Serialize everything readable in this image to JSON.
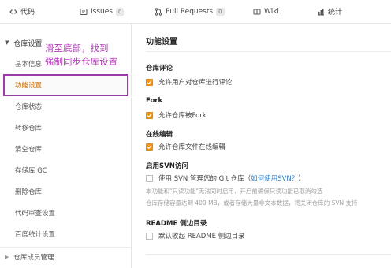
{
  "tabs": [
    {
      "label": "代码",
      "icon": "code-icon"
    },
    {
      "label": "Issues",
      "icon": "issues-icon",
      "count": "0"
    },
    {
      "label": "Pull Requests",
      "icon": "pull-request-icon",
      "count": "0"
    },
    {
      "label": "Wiki",
      "icon": "wiki-icon"
    },
    {
      "label": "统计",
      "icon": "stats-icon"
    }
  ],
  "sidebar": {
    "section": "仓库设置",
    "items": [
      {
        "label": "基本信息"
      },
      {
        "label": "功能设置",
        "active": true
      },
      {
        "label": "仓库状态"
      },
      {
        "label": "转移仓库"
      },
      {
        "label": "清空仓库"
      },
      {
        "label": "存储库 GC"
      },
      {
        "label": "删除仓库"
      },
      {
        "label": "代码审查设置"
      },
      {
        "label": "百度统计设置"
      }
    ],
    "footer": "仓库成员管理"
  },
  "annotation": {
    "line1": "滑至底部，找到",
    "line2": "强制同步仓库设置",
    "color": "#b13ab6"
  },
  "main": {
    "title": "功能设置",
    "sections": {
      "comments": {
        "title": "仓库评论",
        "option": "允许用户对仓库进行评论",
        "checked": true
      },
      "fork": {
        "title": "Fork",
        "option": "允许仓库被Fork",
        "checked": true
      },
      "online_edit": {
        "title": "在线编辑",
        "option": "允许仓库文件在线编辑",
        "checked": true
      },
      "svn": {
        "title": "启用SVN访问",
        "option_prefix": "使用 SVN 管理您的 Git 仓库（",
        "option_link": "如何使用SVN？",
        "option_suffix": "）",
        "checked": false,
        "help1": "本功能和\"只读功能\"无法同时启用，开启前确保只读功能已取消勾选",
        "help2": "仓库存储容量达到 400 MB，或者存储大量非文本数据，将关闭仓库的 SVN 支持"
      },
      "readme": {
        "title": "README 侧边目录",
        "option": "默认收起 README 侧边目录",
        "checked": false
      }
    }
  },
  "colors": {
    "accent": "#f0951b",
    "link": "#2f7ecb",
    "annotation": "#9b3aa8"
  }
}
